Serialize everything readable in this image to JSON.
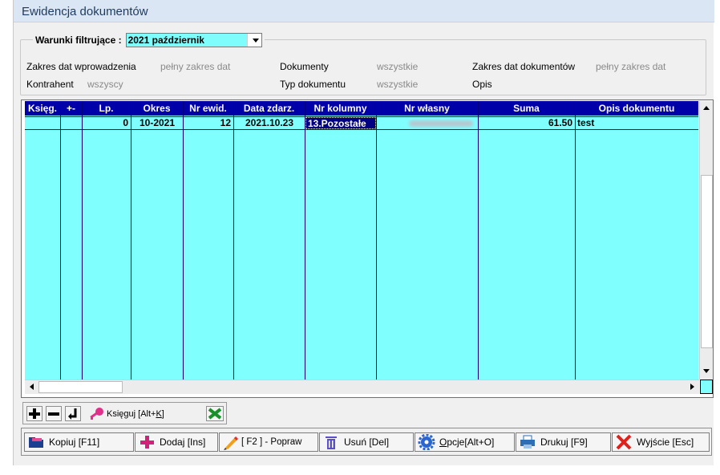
{
  "window": {
    "title": "Ewidencja dokumentów"
  },
  "filter": {
    "legend_label": "Warunki filtrujące :",
    "selected": "2021 październik",
    "fields": [
      {
        "label": "Zakres dat wprowadzenia",
        "value": "pełny zakres dat"
      },
      {
        "label": "Dokumenty",
        "value": "wszystkie"
      },
      {
        "label": "Zakres dat dokumentów",
        "value": "pełny zakres dat"
      },
      {
        "label": "Kontrahent",
        "value": "wszyscy"
      },
      {
        "label": "Typ dokumentu",
        "value": "wszystkie"
      },
      {
        "label": "Opis",
        "value": ""
      }
    ]
  },
  "table": {
    "columns": [
      "Księg.",
      "+-",
      "Lp.",
      "Okres",
      "Nr ewid.",
      "Data zdarz.",
      "Nr kolumny",
      "Nr własny",
      "Suma",
      "Opis dokumentu"
    ],
    "rows": [
      {
        "ksieg": "",
        "pm": "",
        "lp": "0",
        "okres": "10-2021",
        "nr_ewid": "12",
        "data_zdarz": "2021.10.23",
        "nr_kolumny": "13.Pozostałe",
        "nr_wlasny": "",
        "suma": "61.50",
        "opis": "test"
      }
    ]
  },
  "tools": {
    "ksieguj_label": "Księguj [Alt+",
    "ksieguj_key": "K",
    "ksieguj_end": "]"
  },
  "buttons": {
    "kopiuj": "Kopiuj  [F11]",
    "dodaj": "Dodaj  [Ins]",
    "popraw": "[ F2 ] - Popraw",
    "usun": "Usuń  [Del]",
    "opcje_key": "O",
    "opcje_rest": "pcje[Alt+O]",
    "drukuj": "Drukuj  [F9]",
    "wyjscie": "Wyjście  [Esc]"
  },
  "colors": {
    "grid_bg": "#80ffff",
    "header_bg": "#0000a8",
    "selected_cell": "#000080"
  }
}
